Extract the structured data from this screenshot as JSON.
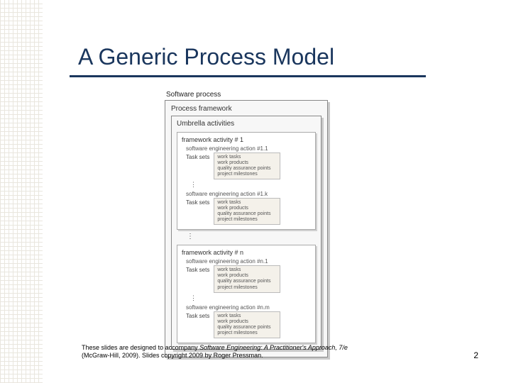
{
  "title": "A Generic Process Model",
  "page_number": "2",
  "footer": {
    "line1_pre": "These slides are designed to accompany ",
    "book_title": "Software Engineering: A Practitioner's Approach, 7/e",
    "line2": "(McGraw-Hill, 2009). Slides copyright 2009 by Roger Pressman."
  },
  "diagram": {
    "software_process": "Software process",
    "process_framework": "Process framework",
    "umbrella": "Umbrella activities",
    "fa1": {
      "title": "framework activity # 1",
      "action1": "software engineering action #1.1",
      "actionK": "software engineering action #1.k",
      "task_sets": "Task sets",
      "mini_items": [
        "work tasks",
        "work products",
        "quality assurance points",
        "project milestones"
      ]
    },
    "faN": {
      "title": "framework activity # n",
      "action1": "software engineering action #n.1",
      "actionM": "software engineering action #n.m",
      "task_sets": "Task sets",
      "mini_items": [
        "work tasks",
        "work products",
        "quality assurance points",
        "project milestones"
      ]
    }
  }
}
